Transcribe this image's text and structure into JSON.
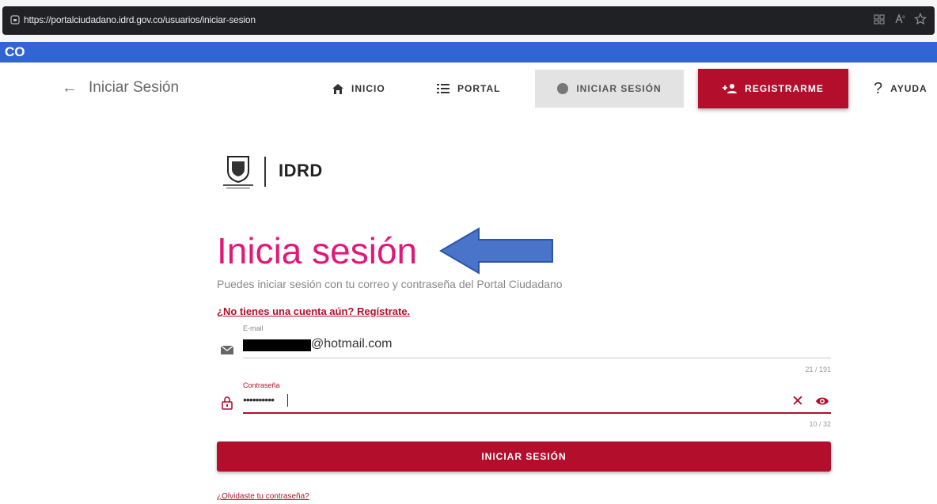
{
  "browser": {
    "url": "https://portalciudadano.idrd.gov.co/usuarios/iniciar-sesion",
    "strip_text": "CO"
  },
  "nav": {
    "back_title": "Iniciar Sesión",
    "items": [
      {
        "label": "INICIO",
        "icon": "home-icon"
      },
      {
        "label": "PORTAL",
        "icon": "list-icon"
      },
      {
        "label": "INICIAR SESIÓN",
        "icon": "user-circle-icon"
      },
      {
        "label": "REGISTRARME",
        "icon": "person-add-icon"
      },
      {
        "label": "AYUDA",
        "icon": "question-icon"
      }
    ]
  },
  "brand": {
    "name": "IDRD"
  },
  "login": {
    "heading": "Inicia sesión",
    "subtitle": "Puedes iniciar sesión con tu correo y contraseña del Portal Ciudadano",
    "register_link": "¿No tienes una cuenta aún? Regístrate.",
    "email": {
      "label": "E-mail",
      "value_suffix": "@hotmail.com",
      "counter": "21 / 191"
    },
    "password": {
      "label": "Contraseña",
      "value": "••••••••••",
      "counter": "10 / 32"
    },
    "submit_label": "INICIAR SESIÓN",
    "forgot_link": "¿Olvidaste tu contraseña?"
  },
  "colors": {
    "accent": "#b30f2d",
    "heading": "#e0187a",
    "browser_strip": "#3265d4"
  }
}
